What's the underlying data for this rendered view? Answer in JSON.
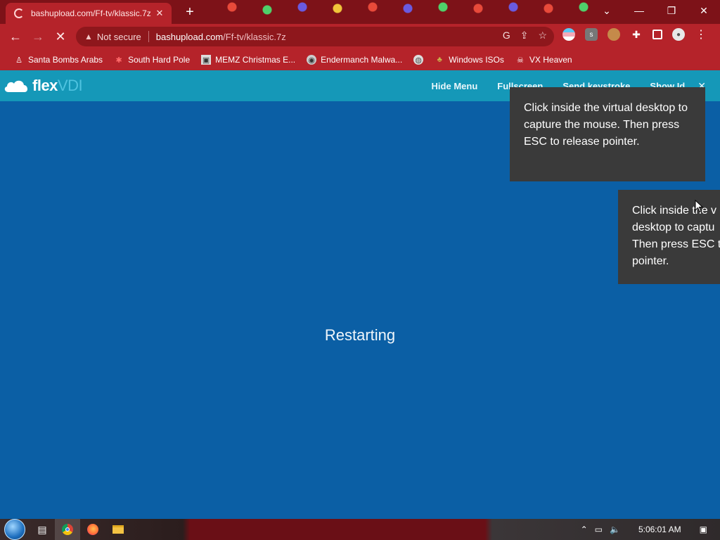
{
  "browser": {
    "tab_title": "bashupload.com/Ff-tv/klassic.7z",
    "tab_close": "✕",
    "new_tab": "+",
    "window_controls": {
      "dropdown": "⌄",
      "minimize": "—",
      "restore": "❐",
      "close": "✕"
    },
    "nav": {
      "back": "←",
      "forward": "→",
      "reload": "✕"
    },
    "omnibox": {
      "security_text": "Not secure",
      "url_host": "bashupload.com",
      "url_path": "/Ff-tv/klassic.7z"
    },
    "menu_icon": "⋮"
  },
  "bookmarks": [
    {
      "label": "Santa Bombs Arabs",
      "icon": "user-icon"
    },
    {
      "label": "South Hard Pole",
      "icon": "snowflake-icon"
    },
    {
      "label": "MEMZ Christmas E...",
      "icon": "image-icon"
    },
    {
      "label": "Endermanch Malwa...",
      "icon": "raccoon-icon"
    },
    {
      "label": "",
      "icon": "globe-icon"
    },
    {
      "label": "Windows ISOs",
      "icon": "tree-icon"
    },
    {
      "label": "VX Heaven",
      "icon": "skull-icon"
    }
  ],
  "flexvdi": {
    "logo_text_flex": "flex",
    "logo_text_vdi": "VDI",
    "menu": {
      "hide_menu": "Hide Menu",
      "fullscreen": "Fullscreen",
      "send_keystroke": "Send keystroke",
      "show_id": "Show Id"
    },
    "close": "✕"
  },
  "desktop": {
    "status_text": "Restarting",
    "tooltip_text": "Click inside the virtual desktop to capture the mouse. Then press ESC to release pointer.",
    "tooltip2_line1": "Click inside the v",
    "tooltip2_line2": "desktop to captu",
    "tooltip2_line3": "Then press ESC t",
    "tooltip2_line4": "pointer."
  },
  "taskbar": {
    "clock": "5:06:01 AM"
  },
  "colors": {
    "theme_dark": "#7d1218",
    "theme_red": "#b5232a",
    "flexbar": "#1598b8",
    "desktop_bg": "#0b5fa5",
    "tooltip_bg": "#3a3a3a"
  }
}
